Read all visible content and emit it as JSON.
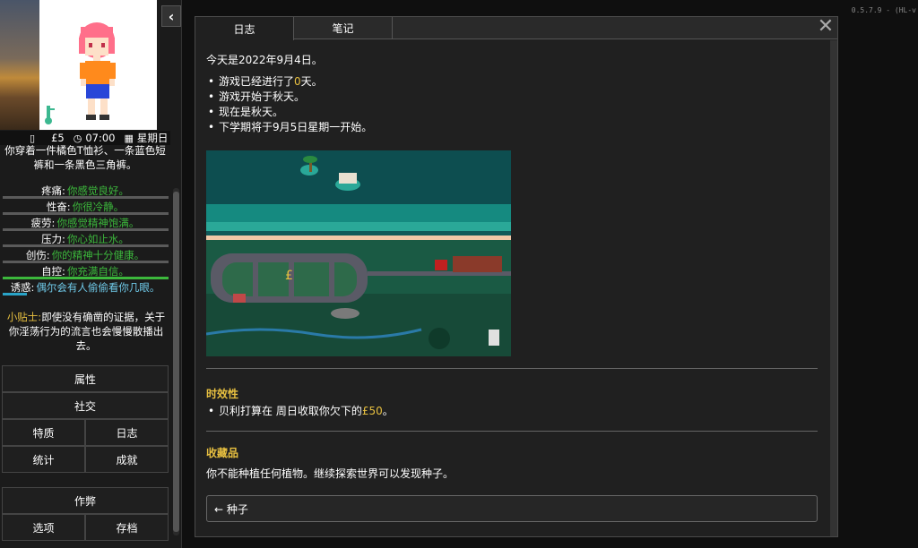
{
  "version": "0.5.7.9 - (HL-v",
  "sidebar": {
    "collapse_icon": "‹",
    "status": {
      "money": "£5",
      "time": "07:00",
      "weekday": "星期日"
    },
    "outfit": "你穿着一件橘色T恤衫、一条蓝色短裤和一条黑色三角裤。",
    "stats": [
      {
        "label": "疼痛:",
        "value": "你感觉良好。"
      },
      {
        "label": "性奋:",
        "value": "你很冷静。"
      },
      {
        "label": "疲劳:",
        "value": "你感觉精神饱满。"
      },
      {
        "label": "压力:",
        "value": "你心如止水。"
      },
      {
        "label": "创伤:",
        "value": "你的精神十分健康。"
      },
      {
        "label": "自控:",
        "value": "你充满自信。"
      },
      {
        "label": "诱惑:",
        "value": "偶尔会有人偷偷看你几眼。"
      }
    ],
    "tip_label": "小贴士:",
    "tip_text": "即使没有确凿的证据，关于你淫荡行为的流言也会慢慢散播出去。",
    "menu": {
      "attributes": "属性",
      "social": "社交",
      "traits": "特质",
      "journal": "日志",
      "statistics": "统计",
      "achievements": "成就",
      "cheat": "作弊",
      "options": "选项",
      "saves": "存档"
    }
  },
  "panel": {
    "tabs": [
      "日志",
      "笔记"
    ],
    "close_icon": "✕",
    "date_line": "今天是2022年9月4日。",
    "bullets": {
      "b1_pre": "游戏已经进行了",
      "b1_days": "0",
      "b1_post": "天。",
      "b2": "游戏开始于秋天。",
      "b3": "现在是秋天。",
      "b4": "下学期将于9月5日星期一开始。"
    },
    "timeliness": {
      "title": "时效性",
      "item_pre": "贝利打算在 周日收取你欠下的",
      "item_amount": "£50",
      "item_post": "。"
    },
    "collectibles": {
      "title": "收藏品",
      "text": "你不能种植任何植物。继续探索世界可以发现种子。",
      "seeds_button": "← 种子"
    }
  }
}
